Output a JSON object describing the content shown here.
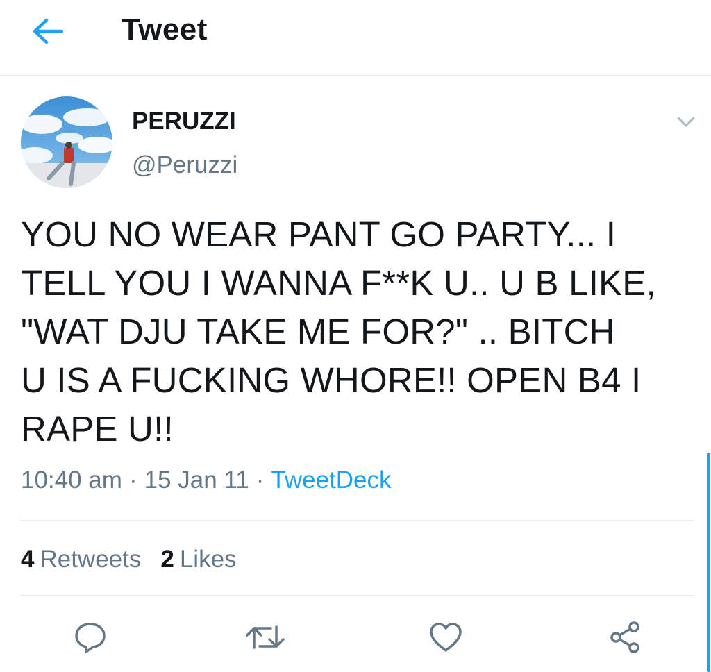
{
  "header": {
    "title": "Tweet",
    "back_icon": "arrow-left-icon"
  },
  "author": {
    "display_name": "PERUZZI",
    "handle": "@Peruzzi"
  },
  "tweet": {
    "text": "YOU NO WEAR PANT GO PARTY... I\nTELL YOU I WANNA F**K U.. U B LIKE,\n\"WAT DJU TAKE ME FOR?\" .. BITCH\nU IS A FUCKING WHORE!! OPEN B4 I\nRAPE U!!",
    "time": "10:40 am",
    "date": "15 Jan 11",
    "source": "TweetDeck",
    "separator": "·"
  },
  "stats": {
    "retweets_count": "4",
    "retweets_label": "Retweets",
    "likes_count": "2",
    "likes_label": "Likes"
  },
  "actions": [
    "reply-icon",
    "retweet-icon",
    "like-icon",
    "share-icon"
  ],
  "colors": {
    "accent": "#1da1f2",
    "text_primary": "#14171a",
    "text_secondary": "#657786",
    "divider": "#e6ecf0",
    "icon": "#657786"
  }
}
